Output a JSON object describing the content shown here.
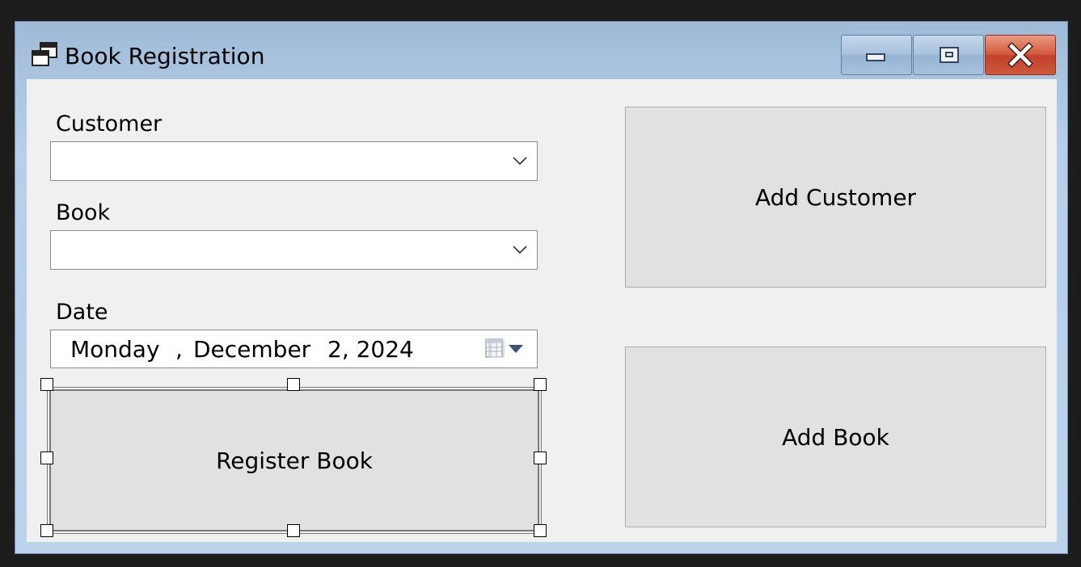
{
  "window": {
    "title": "Book Registration",
    "icon": "form-icon",
    "controls": {
      "minimize": "minimize-icon",
      "maximize": "maximize-icon",
      "close": "close-icon"
    }
  },
  "form": {
    "customer_label": "Customer",
    "customer_value": "",
    "book_label": "Book",
    "book_value": "",
    "date_label": "Date",
    "date": {
      "weekday": "Monday",
      "comma": ",",
      "month": "December",
      "day_year": "2, 2024"
    }
  },
  "buttons": {
    "register_book": "Register Book",
    "add_customer": "Add Customer",
    "add_book": "Add Book"
  },
  "colors": {
    "close_button": "#c94c30",
    "titlebar": "#a9c3df",
    "client_bg": "#f0f0f0",
    "button_bg": "#e1e1e1"
  }
}
